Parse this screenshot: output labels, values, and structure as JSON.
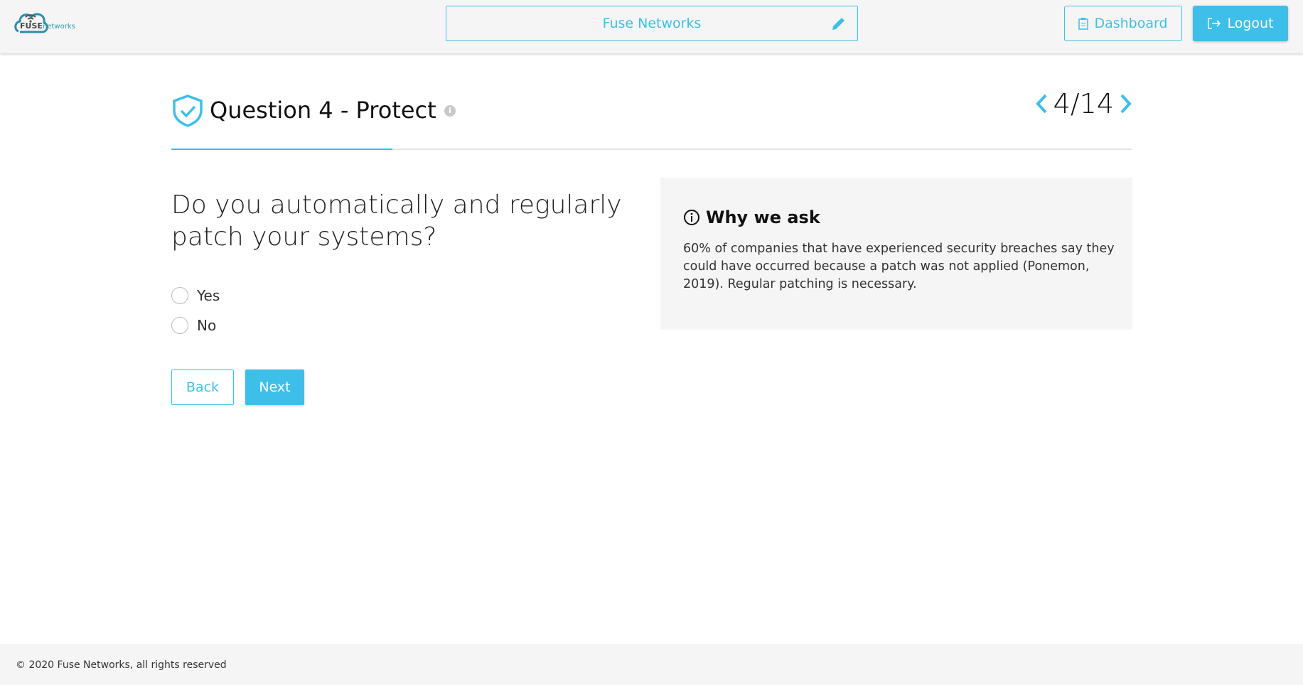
{
  "header": {
    "logo": {
      "text_bold": "FUSE",
      "text_light": "networks"
    },
    "company_name": "Fuse Networks",
    "dashboard_label": "Dashboard",
    "logout_label": "Logout"
  },
  "question": {
    "title": "Question 4 - Protect",
    "pager": "4/14",
    "progress_fraction": 0.23,
    "text": "Do you automatically and regularly patch your systems?",
    "options": [
      {
        "label": "Yes",
        "selected": false
      },
      {
        "label": "No",
        "selected": false
      }
    ],
    "back_label": "Back",
    "next_label": "Next"
  },
  "why": {
    "title": "Why we ask",
    "body": "60% of companies that have experienced security breaches say they could have occurred because a patch was not applied (Ponemon, 2019). Regular patching is necessary."
  },
  "footer": {
    "copyright": "© 2020 Fuse Networks, all rights reserved"
  },
  "colors": {
    "accent": "#3dbfea",
    "panel": "#f5f5f5"
  }
}
